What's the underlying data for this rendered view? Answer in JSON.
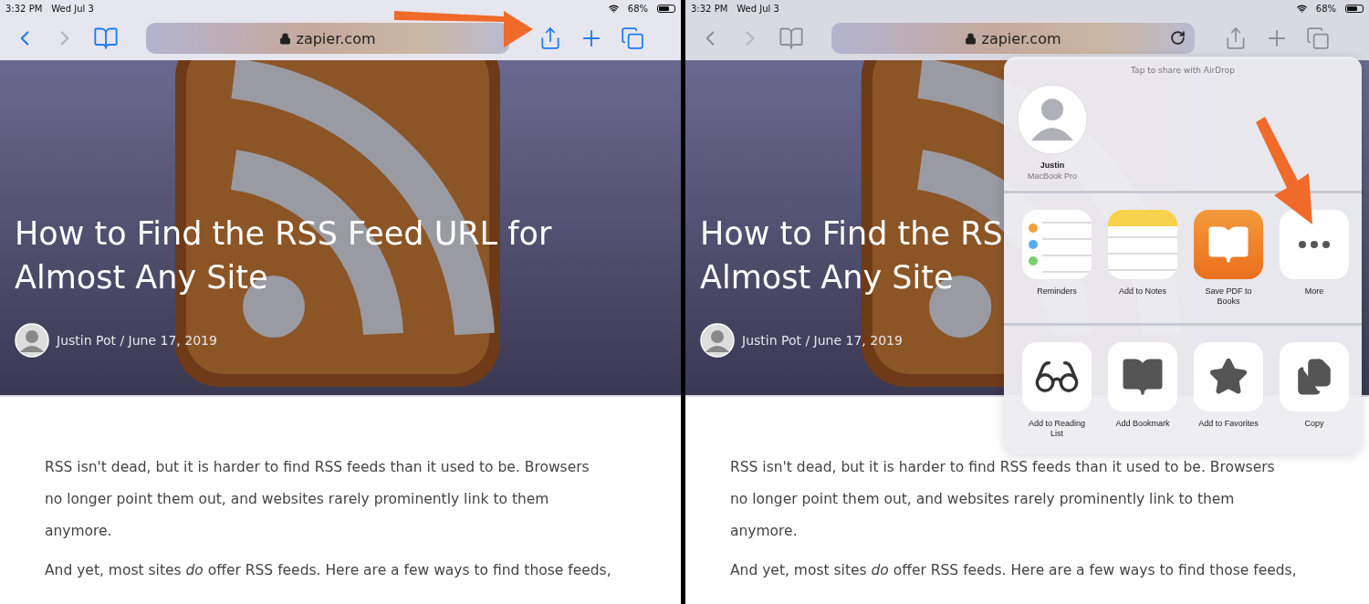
{
  "panes": [
    {
      "status_bar": {
        "time": "3:32 PM",
        "date": "Wed Jul 3",
        "battery": "68%"
      },
      "toolbar": {
        "url": "zapier.com",
        "dimmed": false,
        "reload_button": false
      },
      "article": {
        "title_lines": [
          "How to Find the RSS Feed URL for",
          "Almost Any Site"
        ],
        "byline": "Justin Pot / June 17, 2019",
        "paragraphs": [
          "RSS isn't dead, but it is harder to find RSS feeds than it used to be. Browsers no longer point them out, and websites rarely prominently link to them anymore.",
          "And yet, most sites *do* offer RSS feeds. Here are a few ways to find those feeds,"
        ]
      }
    },
    {
      "status_bar": {
        "time": "3:32 PM",
        "date": "Wed Jul 3",
        "battery": "68%"
      },
      "toolbar": {
        "url": "zapier.com",
        "dimmed": true,
        "reload_button": true
      },
      "article": {
        "title_lines": [
          "How to Find the RS",
          "Almost Any Site"
        ],
        "byline": "Justin Pot / June 17, 2019",
        "paragraphs": [
          "RSS isn't dead, but it is harder to find RSS feeds than it used to be. Browsers no longer point them out, and websites rarely prominently link to them anymore.",
          "And yet, most sites *do* offer RSS feeds. Here are a few ways to find those feeds,"
        ]
      },
      "share_sheet": {
        "airdrop_hint": "Tap to share with AirDrop",
        "airdrop_devices": [
          {
            "name": "Justin",
            "device": "MacBook Pro"
          }
        ],
        "apps": [
          {
            "kind": "reminders",
            "label": "Reminders"
          },
          {
            "kind": "notes",
            "label": "Add to Notes"
          },
          {
            "kind": "books",
            "label": "Save PDF to Books"
          },
          {
            "kind": "more",
            "label": "More"
          }
        ],
        "actions": [
          {
            "kind": "reading-list",
            "label": "Add to Reading List"
          },
          {
            "kind": "bookmark",
            "label": "Add Bookmark"
          },
          {
            "kind": "favorites",
            "label": "Add to Favorites"
          },
          {
            "kind": "copy",
            "label": "Copy"
          }
        ]
      }
    }
  ]
}
